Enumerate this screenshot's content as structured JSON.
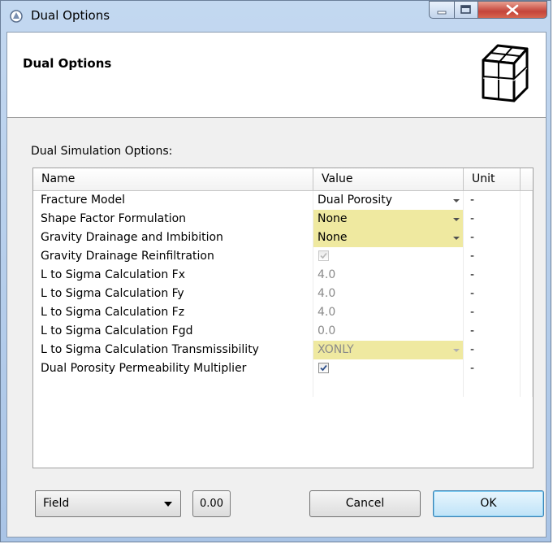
{
  "window": {
    "title": "Dual Options"
  },
  "banner": {
    "title": "Dual Options"
  },
  "group_label": "Dual Simulation Options:",
  "table": {
    "columns": [
      "Name",
      "Value",
      "Unit"
    ],
    "rows": [
      {
        "name": "Fracture Model",
        "value": "Dual Porosity",
        "unit": "-",
        "kind": "dropdown"
      },
      {
        "name": "Shape Factor Formulation",
        "value": "None",
        "unit": "-",
        "kind": "dropdown",
        "highlight": true
      },
      {
        "name": "Gravity Drainage and Imbibition",
        "value": "None",
        "unit": "-",
        "kind": "dropdown",
        "highlight": true
      },
      {
        "name": "Gravity Drainage Reinfiltration",
        "value": "",
        "unit": "-",
        "kind": "checkbox",
        "checked": true,
        "disabled": true
      },
      {
        "name": "L to Sigma Calculation Fx",
        "value": "4.0",
        "unit": "-",
        "kind": "text",
        "disabled": true
      },
      {
        "name": "L to Sigma Calculation Fy",
        "value": "4.0",
        "unit": "-",
        "kind": "text",
        "disabled": true
      },
      {
        "name": "L to Sigma Calculation Fz",
        "value": "4.0",
        "unit": "-",
        "kind": "text",
        "disabled": true
      },
      {
        "name": "L to Sigma Calculation Fgd",
        "value": "0.0",
        "unit": "-",
        "kind": "text",
        "disabled": true
      },
      {
        "name": "L to Sigma Calculation Transmissibility",
        "value": "XONLY",
        "unit": "-",
        "kind": "dropdown",
        "highlight": true,
        "disabled": true
      },
      {
        "name": "Dual Porosity Permeability Multiplier",
        "value": "",
        "unit": "-",
        "kind": "checkbox",
        "checked": true,
        "disabled": false
      }
    ]
  },
  "footer": {
    "unit_system": "Field",
    "small_button": "0.00",
    "cancel_label": "Cancel",
    "ok_label": "OK"
  },
  "colors": {
    "highlight": "#efe9a0",
    "accent": "#3c7fb1"
  },
  "icons": {
    "app": "app-icon",
    "banner": "fractured-cube-icon"
  }
}
